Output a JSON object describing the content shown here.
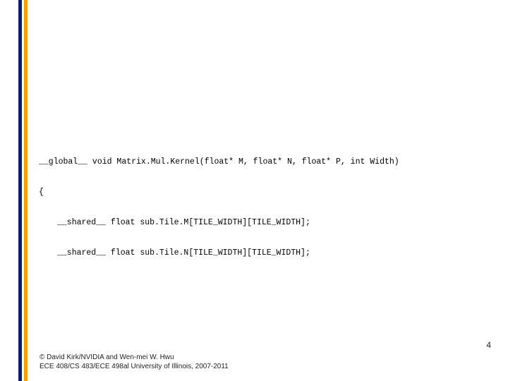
{
  "code": {
    "line1": "__global__ void Matrix.Mul.Kernel(float* M, float* N, float* P, int Width)",
    "line2": "{",
    "line3": "__shared__ float sub.Tile.M[TILE_WIDTH][TILE_WIDTH];",
    "line4": "__shared__ float sub.Tile.N[TILE_WIDTH][TILE_WIDTH];"
  },
  "page_number": "4",
  "copyright": {
    "line1": "© David Kirk/NVIDIA and Wen-mei W. Hwu",
    "line2": "ECE 408/CS 483/ECE 498al University of Illinois, 2007-2011"
  }
}
